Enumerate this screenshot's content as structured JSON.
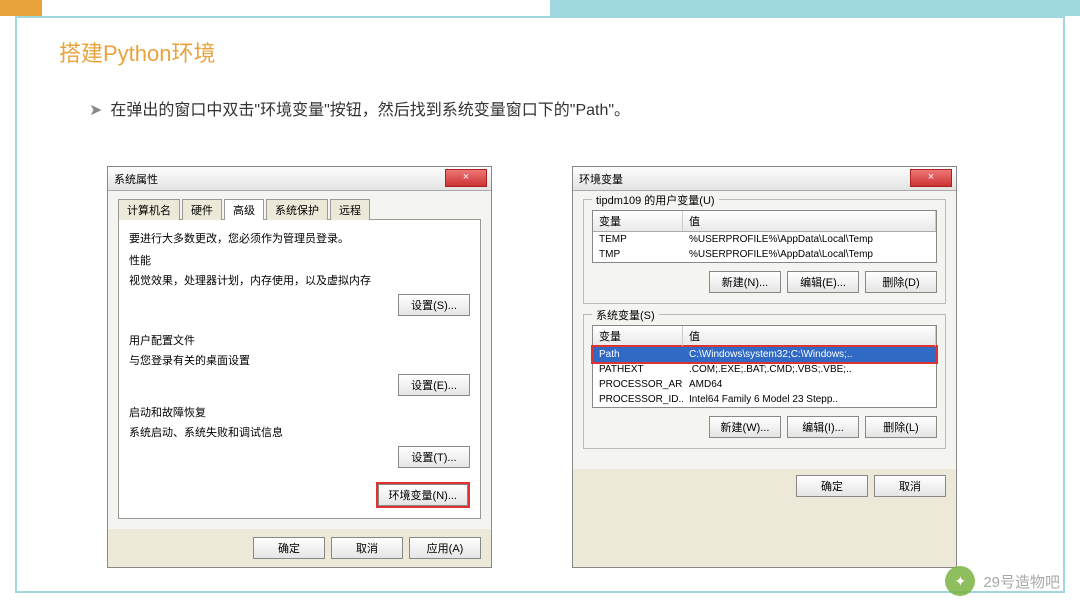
{
  "title": "搭建Python环境",
  "bullet": "在弹出的窗口中双击\"环境变量\"按钮，然后找到系统变量窗口下的\"Path\"。",
  "dlg1": {
    "title": "系统属性",
    "tabs": [
      "计算机名",
      "硬件",
      "高级",
      "系统保护",
      "远程"
    ],
    "note": "要进行大多数更改，您必须作为管理员登录。",
    "perf_title": "性能",
    "perf_desc": "视觉效果，处理器计划，内存使用，以及虚拟内存",
    "btn_s": "设置(S)...",
    "prof_title": "用户配置文件",
    "prof_desc": "与您登录有关的桌面设置",
    "btn_e": "设置(E)...",
    "start_title": "启动和故障恢复",
    "start_desc": "系统启动、系统失败和调试信息",
    "btn_t": "设置(T)...",
    "env_btn": "环境变量(N)...",
    "ok": "确定",
    "cancel": "取消",
    "apply": "应用(A)"
  },
  "dlg2": {
    "title": "环境变量",
    "user_sec": "tipdm109 的用户变量(U)",
    "hdr_var": "变量",
    "hdr_val": "值",
    "user_rows": [
      {
        "k": "TEMP",
        "v": "%USERPROFILE%\\AppData\\Local\\Temp"
      },
      {
        "k": "TMP",
        "v": "%USERPROFILE%\\AppData\\Local\\Temp"
      }
    ],
    "new": "新建(N)...",
    "edit": "编辑(E)...",
    "del": "删除(D)",
    "sys_sec": "系统变量(S)",
    "sys_rows": [
      {
        "k": "Path",
        "v": "C:\\Windows\\system32;C:\\Windows;..",
        "sel": true
      },
      {
        "k": "PATHEXT",
        "v": ".COM;.EXE;.BAT;.CMD;.VBS;.VBE;.."
      },
      {
        "k": "PROCESSOR_AR..",
        "v": "AMD64"
      },
      {
        "k": "PROCESSOR_ID..",
        "v": "Intel64 Family 6 Model 23 Stepp.."
      }
    ],
    "new2": "新建(W)...",
    "edit2": "编辑(I)...",
    "del2": "删除(L)",
    "ok": "确定",
    "cancel": "取消"
  },
  "watermark": "29号造物吧"
}
